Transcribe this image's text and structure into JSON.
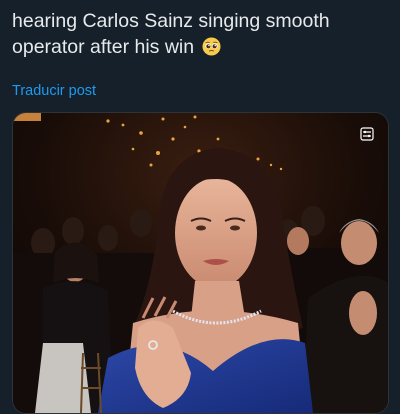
{
  "post": {
    "text": "hearing Carlos Sainz singing smooth operator after his win",
    "emoji": "pleading-face-emoji",
    "translate_label": "Traducir post"
  },
  "media": {
    "kind": "video",
    "badge_icon": "media-settings-icon"
  },
  "colors": {
    "background": "#15202b",
    "text": "#e7e9ea",
    "link": "#1d9bf0"
  }
}
